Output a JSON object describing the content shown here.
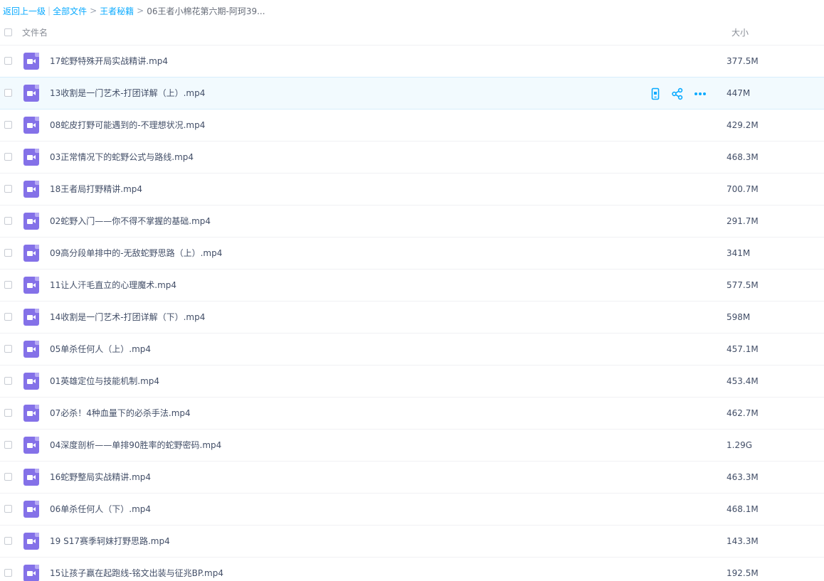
{
  "breadcrumb": {
    "back": "返回上一级",
    "pipe": "|",
    "all_files": "全部文件",
    "sep": ">",
    "parent": "王者秘籍",
    "current": "06王者小棉花第六期-阿珂39..."
  },
  "header": {
    "name_label": "文件名",
    "size_label": "大小"
  },
  "icons": {
    "file": "video-file-icon",
    "row_actions": [
      "phone-icon",
      "share-icon",
      "more-icon"
    ]
  },
  "colors": {
    "accent": "#09aaff",
    "file_icon": "#8471e8",
    "hover_row": "#f2fafe"
  },
  "files": [
    {
      "name": "17蛇野特殊开局实战精讲.mp4",
      "size": "377.5M"
    },
    {
      "name": "13收割是一门艺术-打团详解（上）.mp4",
      "size": "447M"
    },
    {
      "name": "08蛇皮打野可能遇到的-不理想状况.mp4",
      "size": "429.2M"
    },
    {
      "name": "03正常情况下的蛇野公式与路线.mp4",
      "size": "468.3M"
    },
    {
      "name": "18王者局打野精讲.mp4",
      "size": "700.7M"
    },
    {
      "name": "02蛇野入门——你不得不掌握的基础.mp4",
      "size": "291.7M"
    },
    {
      "name": "09高分段单排中的-无敌蛇野思路（上）.mp4",
      "size": "341M"
    },
    {
      "name": "11让人汗毛直立的心理魔术.mp4",
      "size": "577.5M"
    },
    {
      "name": "14收割是一门艺术-打团详解（下）.mp4",
      "size": "598M"
    },
    {
      "name": "05单杀任何人（上）.mp4",
      "size": "457.1M"
    },
    {
      "name": "01英雄定位与技能机制.mp4",
      "size": "453.4M"
    },
    {
      "name": "07必杀！4种血量下的必杀手法.mp4",
      "size": "462.7M"
    },
    {
      "name": "04深度剖析——单排90胜率的蛇野密码.mp4",
      "size": "1.29G"
    },
    {
      "name": "16蛇野整局实战精讲.mp4",
      "size": "463.3M"
    },
    {
      "name": "06单杀任何人（下）.mp4",
      "size": "468.1M"
    },
    {
      "name": "19 S17赛季轲妹打野思路.mp4",
      "size": "143.3M"
    },
    {
      "name": "15让孩子赢在起跑线-铭文出装与征兆BP.mp4",
      "size": "192.5M"
    }
  ]
}
